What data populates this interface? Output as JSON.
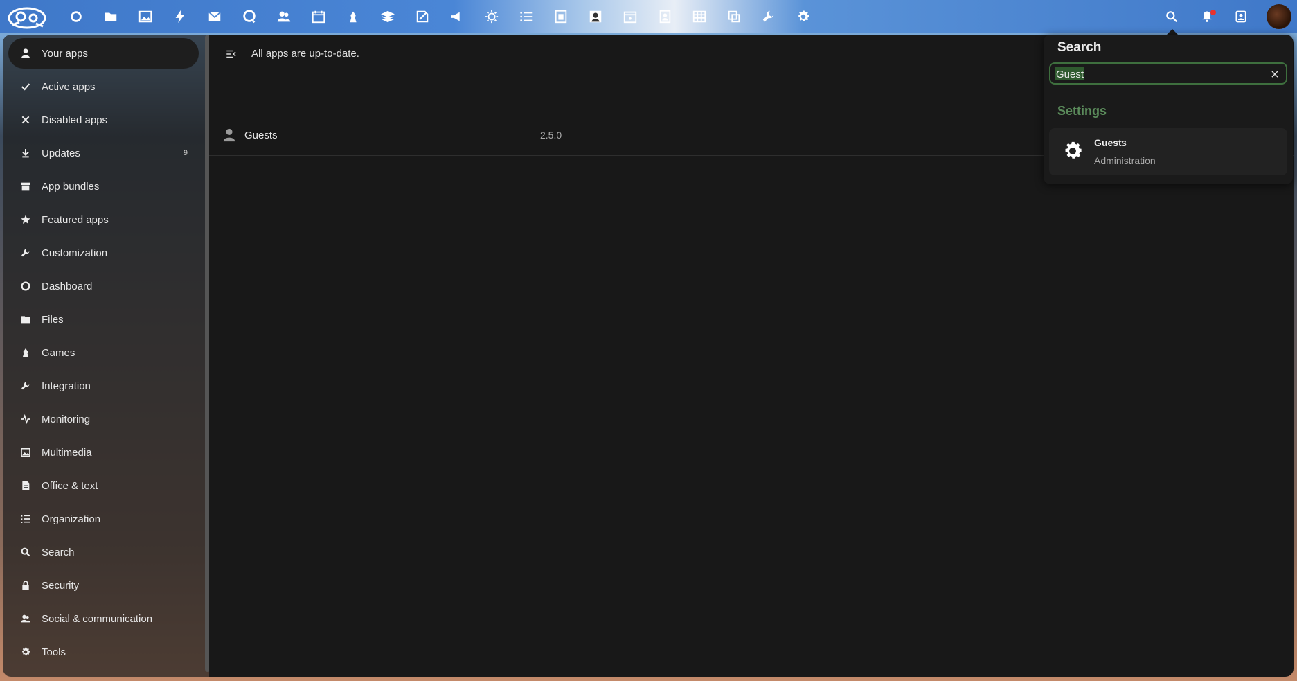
{
  "header": {
    "logo": "nextcloud-logo",
    "apps": [
      {
        "name": "dashboard-icon"
      },
      {
        "name": "files-icon"
      },
      {
        "name": "photos-icon"
      },
      {
        "name": "activity-icon"
      },
      {
        "name": "mail-icon"
      },
      {
        "name": "talk-icon"
      },
      {
        "name": "contacts-icon"
      },
      {
        "name": "calendar-icon"
      },
      {
        "name": "games-icon"
      },
      {
        "name": "deck-icon"
      },
      {
        "name": "notes-icon"
      },
      {
        "name": "announcement-icon"
      },
      {
        "name": "weather-icon"
      },
      {
        "name": "tasks-icon"
      },
      {
        "name": "forms-icon"
      },
      {
        "name": "photo-frame-icon"
      },
      {
        "name": "calendar-schedule-icon"
      },
      {
        "name": "contacts-book-icon"
      },
      {
        "name": "tables-icon"
      },
      {
        "name": "collectives-icon"
      },
      {
        "name": "admin-tools-icon"
      },
      {
        "name": "settings-gear-icon"
      }
    ]
  },
  "nav": {
    "items": [
      {
        "label": "Your apps",
        "icon": "user-icon",
        "active": true
      },
      {
        "label": "Active apps",
        "icon": "check-icon"
      },
      {
        "label": "Disabled apps",
        "icon": "close-icon"
      },
      {
        "label": "Updates",
        "icon": "download-icon",
        "count": "9"
      },
      {
        "label": "App bundles",
        "icon": "bundle-icon"
      },
      {
        "label": "Featured apps",
        "icon": "star-icon"
      },
      {
        "label": "Customization",
        "icon": "wrench-icon"
      },
      {
        "label": "Dashboard",
        "icon": "circle-icon"
      },
      {
        "label": "Files",
        "icon": "folder-icon"
      },
      {
        "label": "Games",
        "icon": "chess-icon"
      },
      {
        "label": "Integration",
        "icon": "wrench-icon"
      },
      {
        "label": "Monitoring",
        "icon": "pulse-icon"
      },
      {
        "label": "Multimedia",
        "icon": "image-icon"
      },
      {
        "label": "Office & text",
        "icon": "document-icon"
      },
      {
        "label": "Organization",
        "icon": "list-icon"
      },
      {
        "label": "Search",
        "icon": "search-icon"
      },
      {
        "label": "Security",
        "icon": "lock-icon"
      },
      {
        "label": "Social & communication",
        "icon": "people-icon"
      },
      {
        "label": "Tools",
        "icon": "gear-icon"
      }
    ]
  },
  "main": {
    "status": "All apps are up-to-date.",
    "apps": [
      {
        "name": "Guests",
        "version": "2.5.0"
      }
    ]
  },
  "search": {
    "title": "Search",
    "value": "Guest",
    "section": "Settings",
    "results": [
      {
        "title_match": "Guest",
        "title_rest": "s",
        "subtitle": "Administration"
      }
    ]
  },
  "colors": {
    "accent_green": "#5b8b5b",
    "header_blue": "#3f78c9",
    "notification_red": "#e9322d"
  }
}
